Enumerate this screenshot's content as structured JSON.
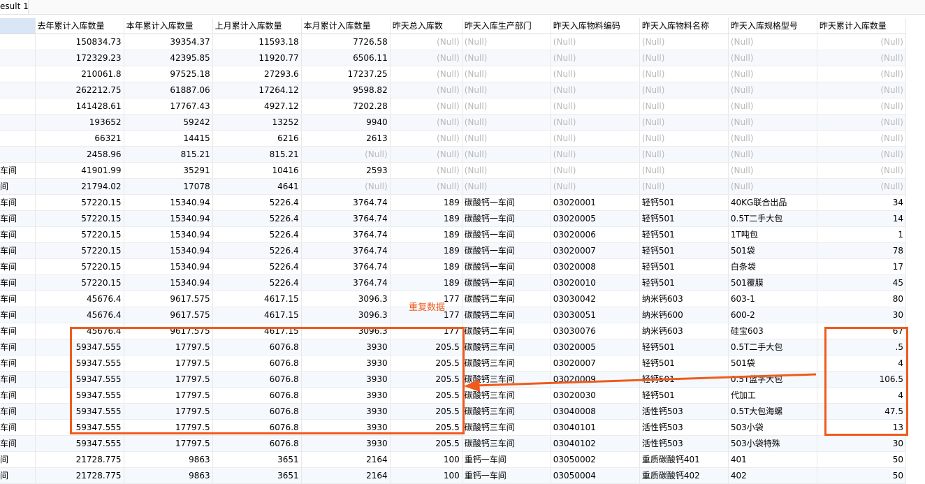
{
  "tab": {
    "label": "esult 1"
  },
  "columns": [
    "",
    "去年累计入库数量",
    "本年累计入库数量",
    "上月累计入库数量",
    "本月累计入库数量",
    "昨天总入库数",
    "昨天入库生产部门",
    "昨天入库物料编码",
    "昨天入库物料名称",
    "昨天入库规格型号",
    "昨天累计入库数量"
  ],
  "rows": [
    [
      "",
      "150834.73",
      "39354.37",
      "11593.18",
      "7726.58",
      "(Null)",
      "(Null)",
      "(Null)",
      "(Null)",
      "(Null)",
      "(Null)"
    ],
    [
      "",
      "172329.23",
      "42395.85",
      "11920.77",
      "6506.11",
      "(Null)",
      "(Null)",
      "(Null)",
      "(Null)",
      "(Null)",
      "(Null)"
    ],
    [
      "",
      "210061.8",
      "97525.18",
      "27293.6",
      "17237.25",
      "(Null)",
      "(Null)",
      "(Null)",
      "(Null)",
      "(Null)",
      "(Null)"
    ],
    [
      "",
      "262212.75",
      "61887.06",
      "17264.12",
      "9598.82",
      "(Null)",
      "(Null)",
      "(Null)",
      "(Null)",
      "(Null)",
      "(Null)"
    ],
    [
      "",
      "141428.61",
      "17767.43",
      "4927.12",
      "7202.28",
      "(Null)",
      "(Null)",
      "(Null)",
      "(Null)",
      "(Null)",
      "(Null)"
    ],
    [
      "",
      "193652",
      "59242",
      "13252",
      "9940",
      "(Null)",
      "(Null)",
      "(Null)",
      "(Null)",
      "(Null)",
      "(Null)"
    ],
    [
      "",
      "66321",
      "14415",
      "6216",
      "2613",
      "(Null)",
      "(Null)",
      "(Null)",
      "(Null)",
      "(Null)",
      "(Null)"
    ],
    [
      "",
      "2458.96",
      "815.21",
      "815.21",
      "(Null)",
      "(Null)",
      "(Null)",
      "(Null)",
      "(Null)",
      "(Null)",
      "(Null)"
    ],
    [
      "车间",
      "41901.99",
      "35291",
      "10416",
      "2593",
      "(Null)",
      "(Null)",
      "(Null)",
      "(Null)",
      "(Null)",
      "(Null)"
    ],
    [
      "间",
      "21794.02",
      "17078",
      "4641",
      "(Null)",
      "(Null)",
      "(Null)",
      "(Null)",
      "(Null)",
      "(Null)",
      "(Null)"
    ],
    [
      "车间",
      "57220.15",
      "15340.94",
      "5226.4",
      "3764.74",
      "189",
      "碳酸钙一车间",
      "03020001",
      "轻钙501",
      "40KG联合出品",
      "34"
    ],
    [
      "车间",
      "57220.15",
      "15340.94",
      "5226.4",
      "3764.74",
      "189",
      "碳酸钙一车间",
      "03020005",
      "轻钙501",
      "0.5T二手大包",
      "14"
    ],
    [
      "车间",
      "57220.15",
      "15340.94",
      "5226.4",
      "3764.74",
      "189",
      "碳酸钙一车间",
      "03020006",
      "轻钙501",
      "1T吨包",
      "1"
    ],
    [
      "车间",
      "57220.15",
      "15340.94",
      "5226.4",
      "3764.74",
      "189",
      "碳酸钙一车间",
      "03020007",
      "轻钙501",
      "501袋",
      "78"
    ],
    [
      "车间",
      "57220.15",
      "15340.94",
      "5226.4",
      "3764.74",
      "189",
      "碳酸钙一车间",
      "03020008",
      "轻钙501",
      "白条袋",
      "17"
    ],
    [
      "车间",
      "57220.15",
      "15340.94",
      "5226.4",
      "3764.74",
      "189",
      "碳酸钙一车间",
      "03020010",
      "轻钙501",
      "501覆膜",
      "45"
    ],
    [
      "车间",
      "45676.4",
      "9617.575",
      "4617.15",
      "3096.3",
      "177",
      "碳酸钙二车间",
      "03030042",
      "纳米钙603",
      "603-1",
      "80"
    ],
    [
      "车间",
      "45676.4",
      "9617.575",
      "4617.15",
      "3096.3",
      "177",
      "碳酸钙二车间",
      "03030051",
      "纳米钙600",
      "600-2",
      "30"
    ],
    [
      "车间",
      "45676.4",
      "9617.575",
      "4617.15",
      "3096.3",
      "177",
      "碳酸钙二车间",
      "03030076",
      "纳米钙603",
      "硅宝603",
      "67"
    ],
    [
      "车间",
      "59347.555",
      "17797.5",
      "6076.8",
      "3930",
      "205.5",
      "碳酸钙三车间",
      "03020005",
      "轻钙501",
      "0.5T二手大包",
      ".5"
    ],
    [
      "车间",
      "59347.555",
      "17797.5",
      "6076.8",
      "3930",
      "205.5",
      "碳酸钙三车间",
      "03020007",
      "轻钙501",
      "501袋",
      "4"
    ],
    [
      "车间",
      "59347.555",
      "17797.5",
      "6076.8",
      "3930",
      "205.5",
      "碳酸钙三车间",
      "03020009",
      "轻钙501",
      "0.5T蓝字大包",
      "106.5"
    ],
    [
      "车间",
      "59347.555",
      "17797.5",
      "6076.8",
      "3930",
      "205.5",
      "碳酸钙三车间",
      "03020030",
      "轻钙501",
      "代加工",
      "4"
    ],
    [
      "车间",
      "59347.555",
      "17797.5",
      "6076.8",
      "3930",
      "205.5",
      "碳酸钙三车间",
      "03040008",
      "活性钙503",
      "0.5T大包海螺",
      "47.5"
    ],
    [
      "车间",
      "59347.555",
      "17797.5",
      "6076.8",
      "3930",
      "205.5",
      "碳酸钙三车间",
      "03040101",
      "活性钙503",
      "503小袋",
      "13"
    ],
    [
      "车间",
      "59347.555",
      "17797.5",
      "6076.8",
      "3930",
      "205.5",
      "碳酸钙三车间",
      "03040102",
      "活性钙503",
      "503小袋特殊",
      "30"
    ],
    [
      "间",
      "21728.775",
      "9863",
      "3651",
      "2164",
      "100",
      "重钙一车间",
      "03050002",
      "重质碳酸钙401",
      "401",
      "50"
    ],
    [
      "间",
      "21728.775",
      "9863",
      "3651",
      "2164",
      "100",
      "重钙一车间",
      "03050004",
      "重质碳酸钙402",
      "402",
      "50"
    ]
  ],
  "annotation": {
    "label": "重复数据",
    "color": "#f05a1c"
  }
}
